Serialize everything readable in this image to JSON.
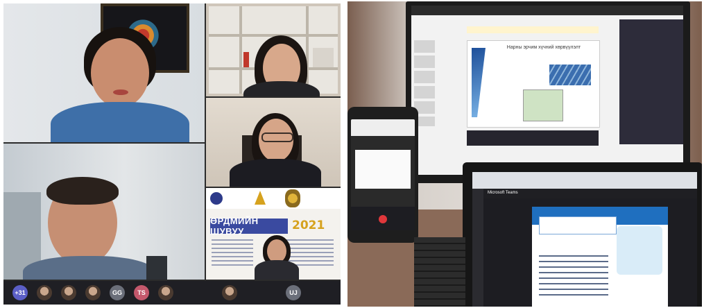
{
  "left_photo": {
    "participant_avatars": [
      {
        "label": "+31",
        "color": "#5b5fc7"
      },
      {
        "label": "",
        "color": "#8a6b55"
      },
      {
        "label": "",
        "color": "#8a6b55"
      },
      {
        "label": "",
        "color": "#8a6b55"
      },
      {
        "label": "GG",
        "color": "#6b6f7a"
      },
      {
        "label": "TS",
        "color": "#c4586c"
      },
      {
        "label": "",
        "color": "#8a6b55"
      }
    ],
    "poster": {
      "title": "ӨРДМИЙН ШУВУУ",
      "year": "2021"
    },
    "bottom_avatars": [
      {
        "label": "",
        "color": "#8a6b55"
      },
      {
        "label": "UJ",
        "color": "#6b6f7a"
      }
    ]
  },
  "right_photo": {
    "monitor_slide_title": "Нарны эрчим хүчний хөрвүүлэлт",
    "laptop_app": "Microsoft Teams"
  }
}
